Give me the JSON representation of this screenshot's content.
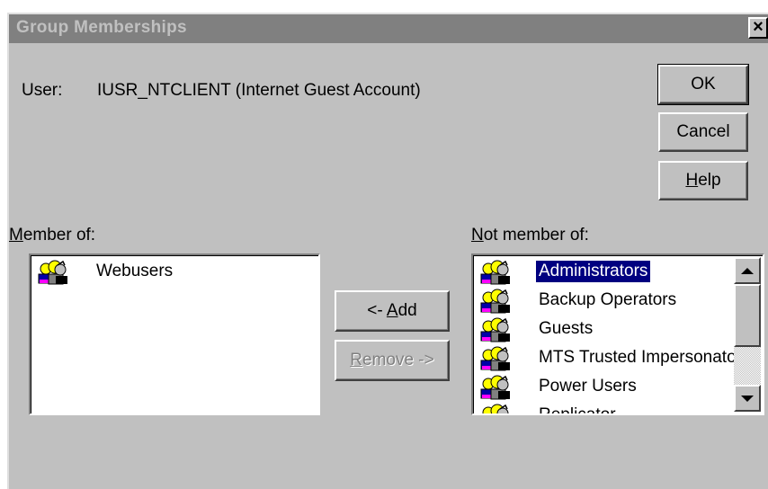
{
  "window": {
    "title": "Group Memberships",
    "close_glyph": "×"
  },
  "user": {
    "label": "User:",
    "value": "IUSR_NTCLIENT (Internet Guest Account)"
  },
  "buttons": {
    "ok": "OK",
    "cancel": "Cancel",
    "help_mnemonic": "H",
    "help_rest": "elp",
    "add_prefix": "<- ",
    "add_mnemonic": "A",
    "add_rest": "dd",
    "remove_mnemonic": "R",
    "remove_rest": "emove ->"
  },
  "member_of": {
    "label_mnemonic": "M",
    "label_rest": "ember of:",
    "items": [
      {
        "label": "Webusers",
        "icon": "group-icon"
      }
    ]
  },
  "not_member_of": {
    "label_mnemonic": "N",
    "label_rest": "ot member of:",
    "items": [
      {
        "label": "Administrators",
        "icon": "group-icon",
        "selected": true
      },
      {
        "label": "Backup Operators",
        "icon": "group-icon",
        "selected": false
      },
      {
        "label": "Guests",
        "icon": "group-icon",
        "selected": false
      },
      {
        "label": "MTS Trusted Impersonators",
        "icon": "group-icon",
        "selected": false
      },
      {
        "label": "Power Users",
        "icon": "group-icon",
        "selected": false
      },
      {
        "label": "Replicator",
        "icon": "group-icon",
        "selected": false
      }
    ]
  },
  "colors": {
    "selection": "#000080",
    "dialog_face": "#c0c0c0",
    "titlebar_inactive": "#808080"
  }
}
